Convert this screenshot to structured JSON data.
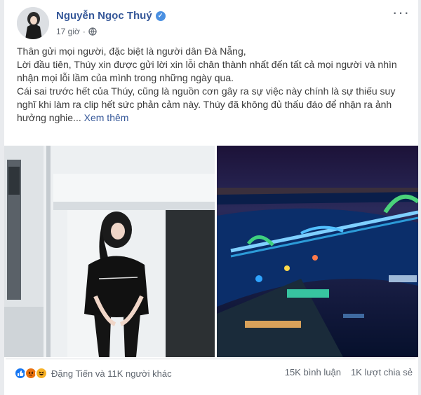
{
  "post": {
    "author": "Nguyễn Ngọc Thuý",
    "time": "17 giờ",
    "privacy_icon": "globe-icon",
    "more_icon": "more-options-icon",
    "paragraphs": [
      "Thân gửi mọi người, đặc biệt là người dân Đà Nẵng,",
      "Lời đầu tiên, Thúy xin được gửi lời xin lỗi chân thành nhất đến tất cả mọi người và nhìn nhận mọi lỗi lầm của mình trong những ngày qua.",
      "Cái sai trước hết của Thúy, cũng là nguồn cơn gây ra sự việc này chính là sự thiếu suy nghĩ khi làm ra clip hết sức phản cảm này. Thúy đã không đủ thấu đáo để nhận ra ảnh hưởng nghie..."
    ],
    "see_more": "Xem thêm"
  },
  "footer": {
    "reactions_text": "Đặng Tiến và 11K người khác",
    "comments": "15K bình luận",
    "shares": "1K lượt chia sẻ",
    "reaction_icons": [
      "like-reaction-icon",
      "angry-reaction-icon",
      "haha-reaction-icon"
    ]
  },
  "colors": {
    "author": "#365899",
    "like": "#1877f2",
    "angry": "#e9710f",
    "haha": "#f7b125"
  }
}
